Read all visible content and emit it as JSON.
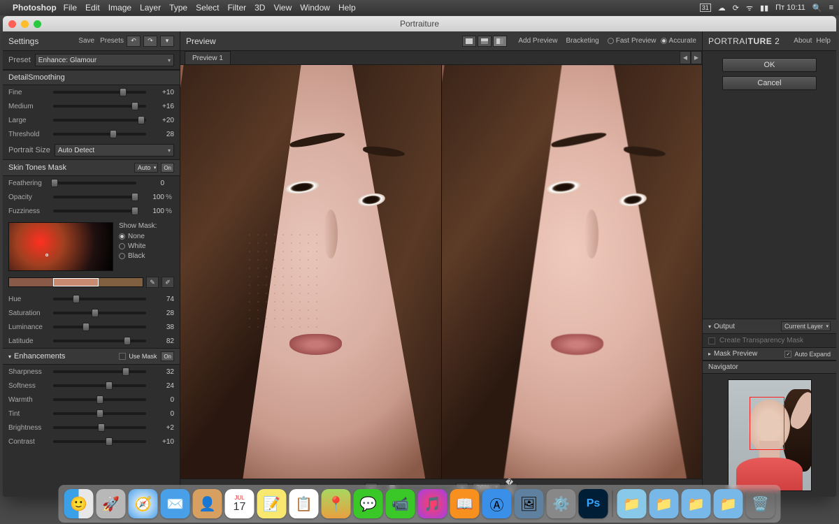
{
  "menubar": {
    "app": "Photoshop",
    "items": [
      "File",
      "Edit",
      "Image",
      "Layer",
      "Type",
      "Select",
      "Filter",
      "3D",
      "View",
      "Window",
      "Help"
    ],
    "clock": "Пт 10:11",
    "date_icon": "31"
  },
  "window": {
    "title": "Portraiture"
  },
  "left": {
    "title": "Settings",
    "save": "Save",
    "presets": "Presets",
    "preset_label": "Preset",
    "preset_value": "Enhance: Glamour",
    "detail": {
      "title": "DetailSmoothing",
      "fine_label": "Fine",
      "fine_val": "+10",
      "medium_label": "Medium",
      "medium_val": "+16",
      "large_label": "Large",
      "large_val": "+20",
      "threshold_label": "Threshold",
      "threshold_val": "28",
      "portrait_size_label": "Portrait Size",
      "portrait_size_val": "Auto Detect"
    },
    "skin": {
      "title": "Skin Tones Mask",
      "mode": "Auto",
      "on": "On",
      "feathering_label": "Feathering",
      "feathering_val": "0",
      "opacity_label": "Opacity",
      "opacity_val": "100",
      "opacity_unit": "%",
      "fuzziness_label": "Fuzziness",
      "fuzziness_val": "100",
      "fuzziness_unit": "%",
      "show_mask": "Show Mask:",
      "mask_none": "None",
      "mask_white": "White",
      "mask_black": "Black",
      "hue_label": "Hue",
      "hue_val": "74",
      "sat_label": "Saturation",
      "sat_val": "28",
      "lum_label": "Luminance",
      "lum_val": "38",
      "lat_label": "Latitude",
      "lat_val": "82"
    },
    "enh": {
      "title": "Enhancements",
      "use_mask": "Use Mask",
      "on": "On",
      "sharp_label": "Sharpness",
      "sharp_val": "32",
      "soft_label": "Softness",
      "soft_val": "24",
      "warm_label": "Warmth",
      "warm_val": "0",
      "tint_label": "Tint",
      "tint_val": "0",
      "bright_label": "Brightness",
      "bright_val": "+2",
      "contrast_label": "Contrast",
      "contrast_val": "+10"
    }
  },
  "center": {
    "title": "Preview",
    "add_preview": "Add Preview",
    "bracketing": "Bracketing",
    "fast_preview": "Fast Preview",
    "accurate": "Accurate",
    "tab1": "Preview 1",
    "zoom": "26%"
  },
  "right": {
    "brand_pre": "PORTRAI",
    "brand_bold": "TURE",
    "brand_num": " 2",
    "about": "About",
    "help": "Help",
    "ok": "OK",
    "cancel": "Cancel",
    "output": "Output",
    "output_val": "Current Layer",
    "trans_mask": "Create Transparency Mask",
    "mask_preview": "Mask Preview",
    "auto_expand": "Auto Expand",
    "navigator": "Navigator"
  },
  "dock": {
    "items": [
      "finder",
      "launchpad",
      "safari",
      "mail",
      "contacts",
      "calendar",
      "notes",
      "reminders",
      "maps",
      "messages",
      "facetime",
      "itunes",
      "ibooks",
      "appstore",
      "preview",
      "settings",
      "photoshop"
    ],
    "cal_month": "JUL",
    "cal_day": "17"
  }
}
